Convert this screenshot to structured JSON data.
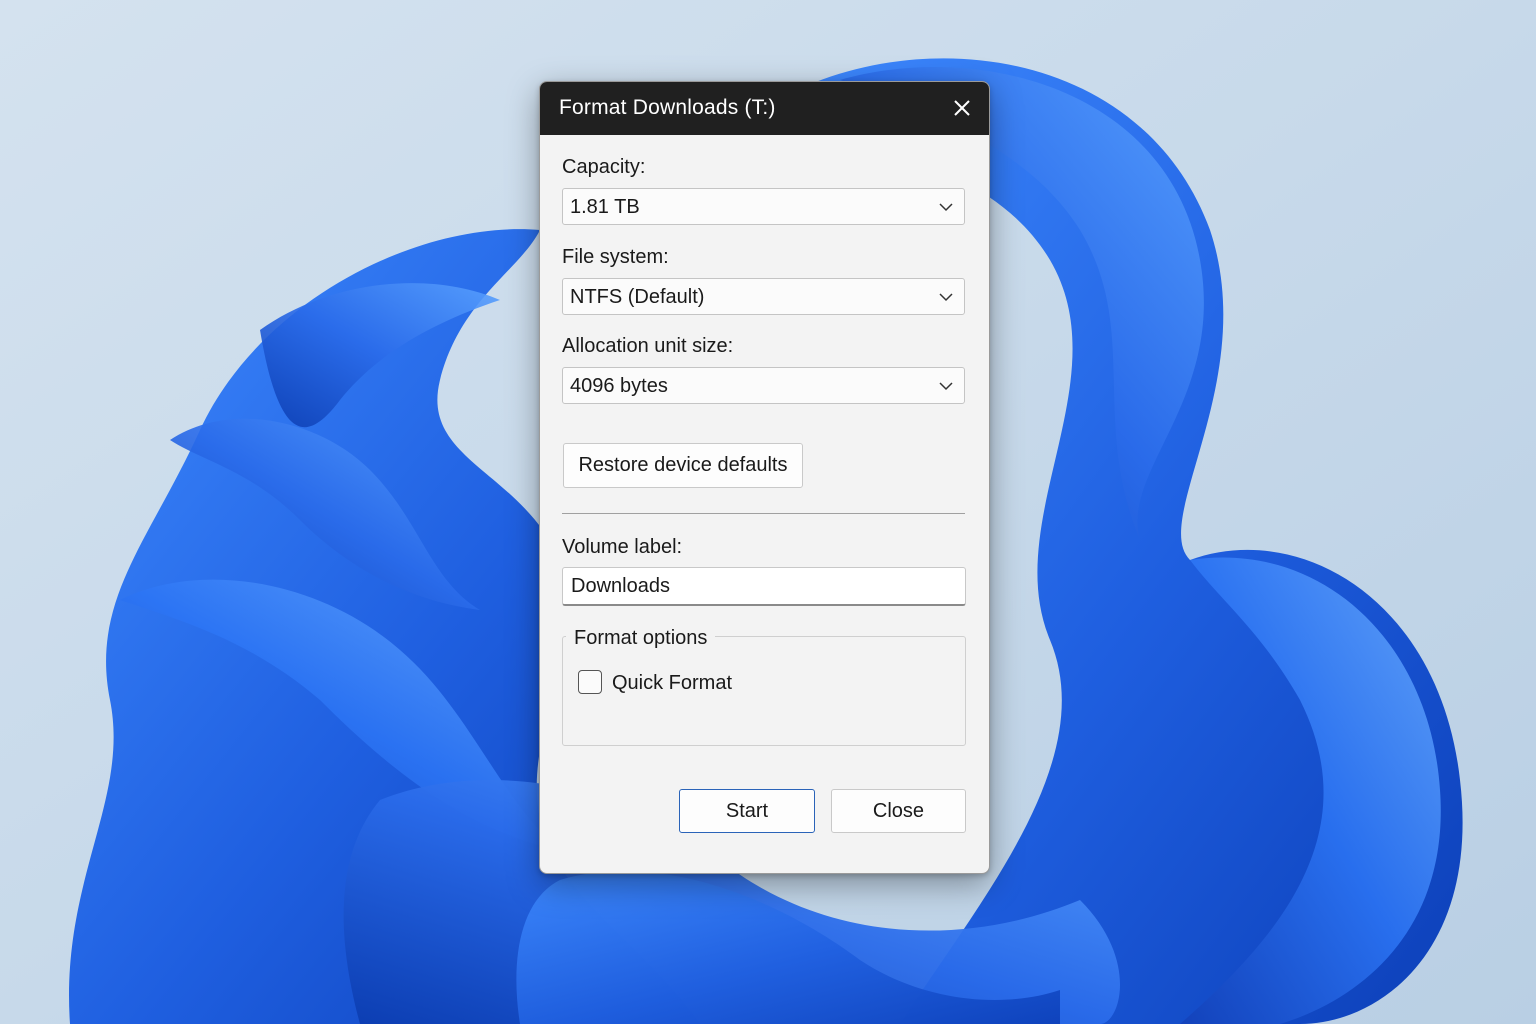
{
  "dialog": {
    "title": "Format Downloads (T:)",
    "close_icon": "close-icon",
    "capacity": {
      "label": "Capacity:",
      "value": "1.81 TB"
    },
    "file_system": {
      "label": "File system:",
      "value": "NTFS (Default)"
    },
    "allocation_unit": {
      "label": "Allocation unit size:",
      "value": "4096 bytes"
    },
    "restore_defaults_label": "Restore device defaults",
    "volume_label": {
      "label": "Volume label:",
      "value": "Downloads"
    },
    "format_options": {
      "legend": "Format options",
      "quick_format_label": "Quick Format",
      "quick_format_checked": false
    },
    "start_label": "Start",
    "close_label": "Close"
  },
  "colors": {
    "titlebar": "#202020",
    "dialog_background": "#f3f3f3",
    "accent": "#2a63b8",
    "wallpaper_bloom": "#1f5fe0"
  }
}
